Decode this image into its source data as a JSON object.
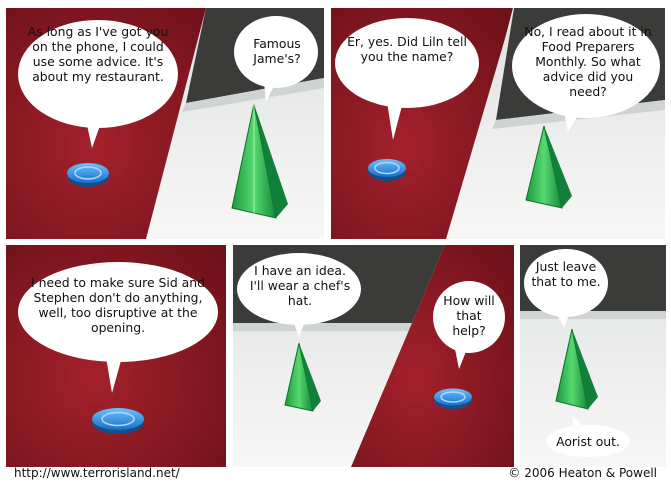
{
  "comic": {
    "panels": [
      {
        "speech": [
          "As long as I've got you on the phone, I could use some advice. It's about my restaurant."
        ]
      },
      {
        "speech": [
          "Famous Jame's?"
        ]
      },
      {
        "speech": [
          "Er, yes. Did Liln tell you the name?"
        ]
      },
      {
        "speech": [
          "No, I read about it in Food Preparers Monthly. So what advice did you need?"
        ]
      },
      {
        "speech": [
          "I need to make sure Sid and Stephen don't do anything, well, too disruptive at the opening."
        ]
      },
      {
        "speech": [
          "I have an idea. I'll wear a chef's hat."
        ]
      },
      {
        "speech": [
          "How will that help?"
        ]
      },
      {
        "speech": [
          "Just leave that to me.",
          "Aorist out."
        ]
      }
    ]
  },
  "footer": {
    "url": "http://www.terrorisland.net/",
    "copyright": "© 2006 Heaton & Powell"
  },
  "colors": {
    "carpet": "#8e1b26",
    "sill": "#e9eaea",
    "glass": "#3a3c3a",
    "chip": "#2c8fe0",
    "pyramid": "#22b14c"
  }
}
